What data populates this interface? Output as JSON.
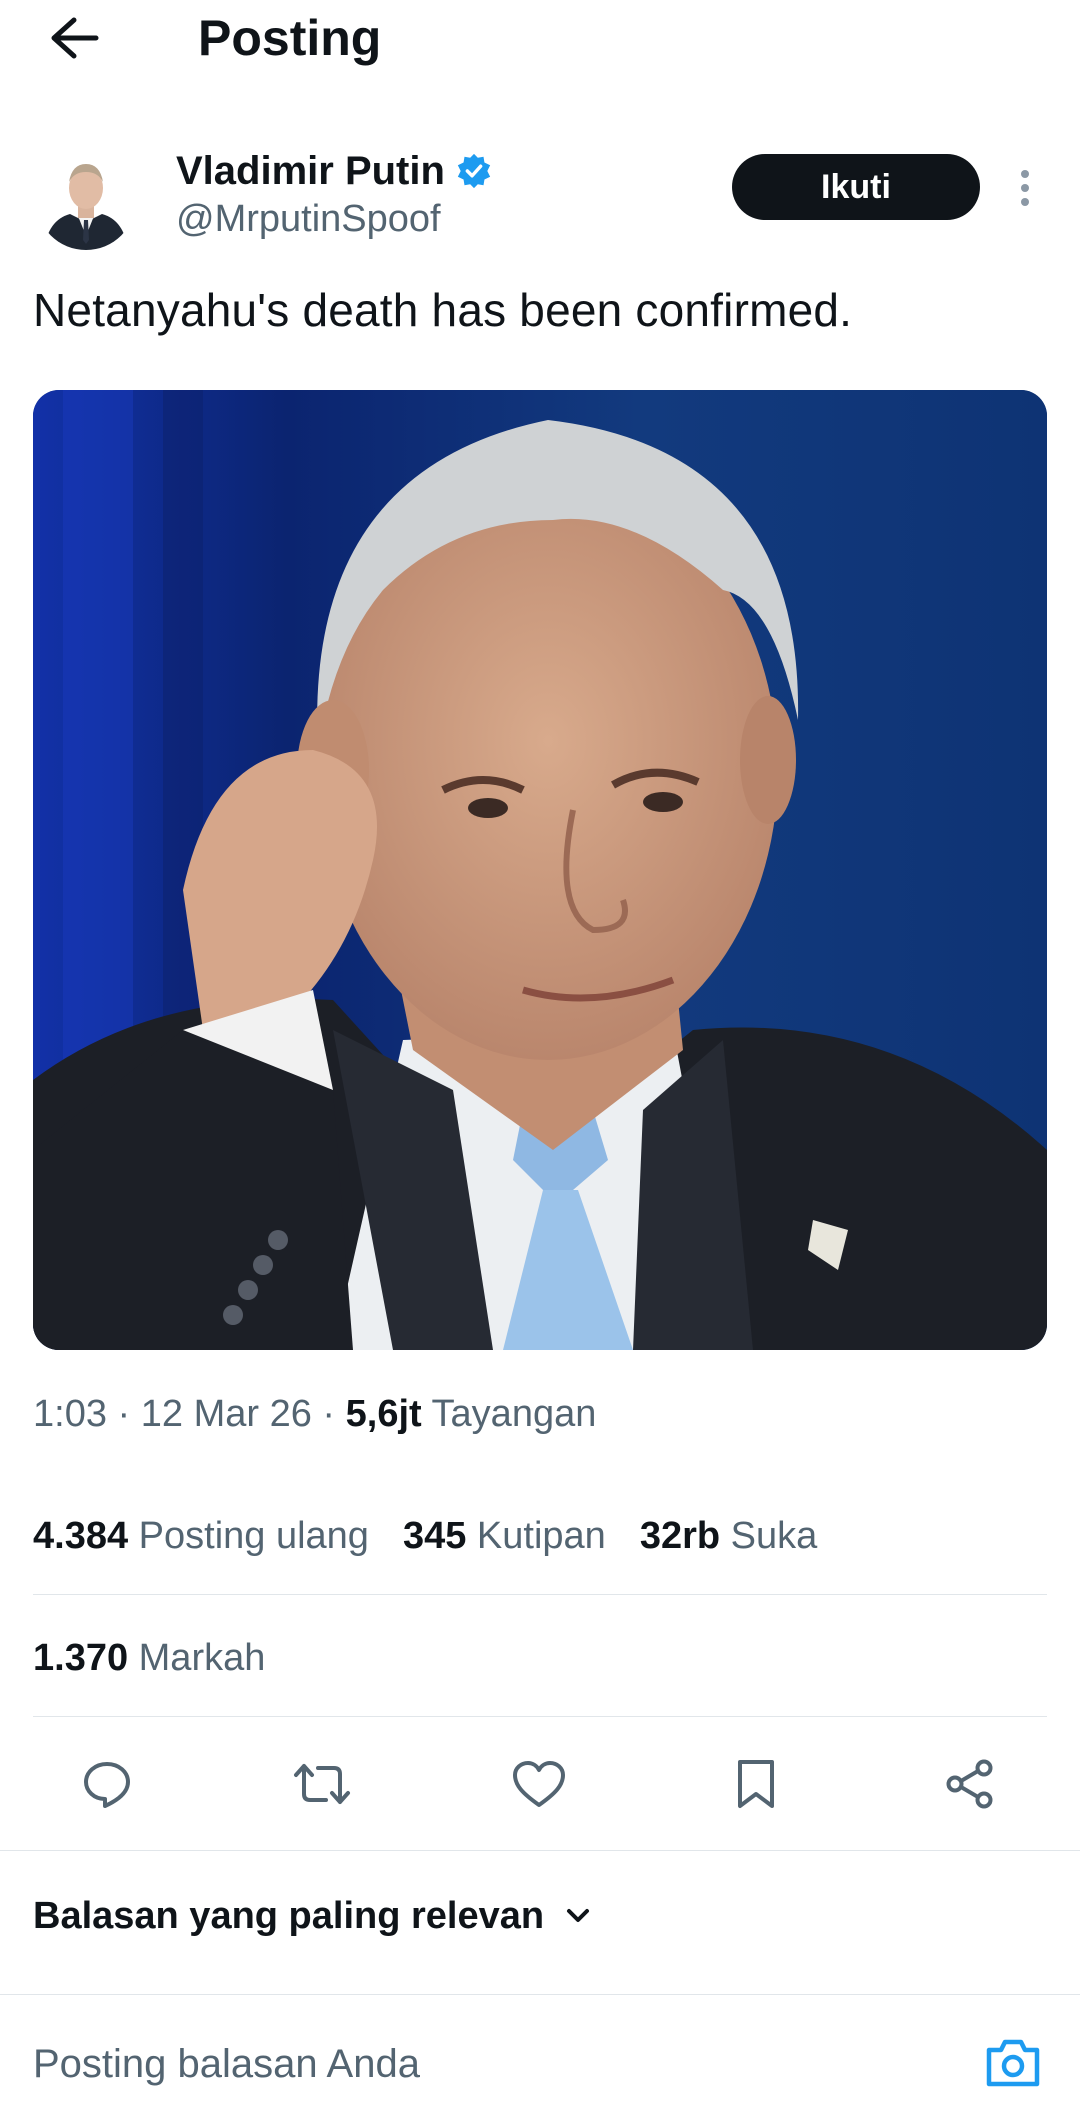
{
  "header": {
    "title": "Posting"
  },
  "author": {
    "display_name": "Vladimir Putin",
    "handle": "@MrputinSpoof",
    "follow_label": "Ikuti"
  },
  "post": {
    "text": "Netanyahu's death has been confirmed.",
    "time": "1:03",
    "date": "12 Mar 26",
    "views": "5,6jt",
    "views_label": "Tayangan"
  },
  "stats": {
    "reposts": "4.384",
    "reposts_label": "Posting ulang",
    "quotes": "345",
    "quotes_label": "Kutipan",
    "likes": "32rb",
    "likes_label": "Suka",
    "bookmarks": "1.370",
    "bookmarks_label": "Markah"
  },
  "replies": {
    "sort_label": "Balasan yang paling relevan",
    "compose_placeholder": "Posting balasan Anda"
  },
  "icons": [
    "arrow-left-icon",
    "verified-badge-icon",
    "more-vertical-icon",
    "reply-icon",
    "repost-icon",
    "like-icon",
    "bookmark-icon",
    "share-icon",
    "chevron-down-icon",
    "camera-icon"
  ],
  "colors": {
    "text": "#0f1419",
    "secondary": "#536471",
    "verified": "#1d9bf0",
    "divider": "#e1e6ea",
    "button": "#0f1419"
  }
}
